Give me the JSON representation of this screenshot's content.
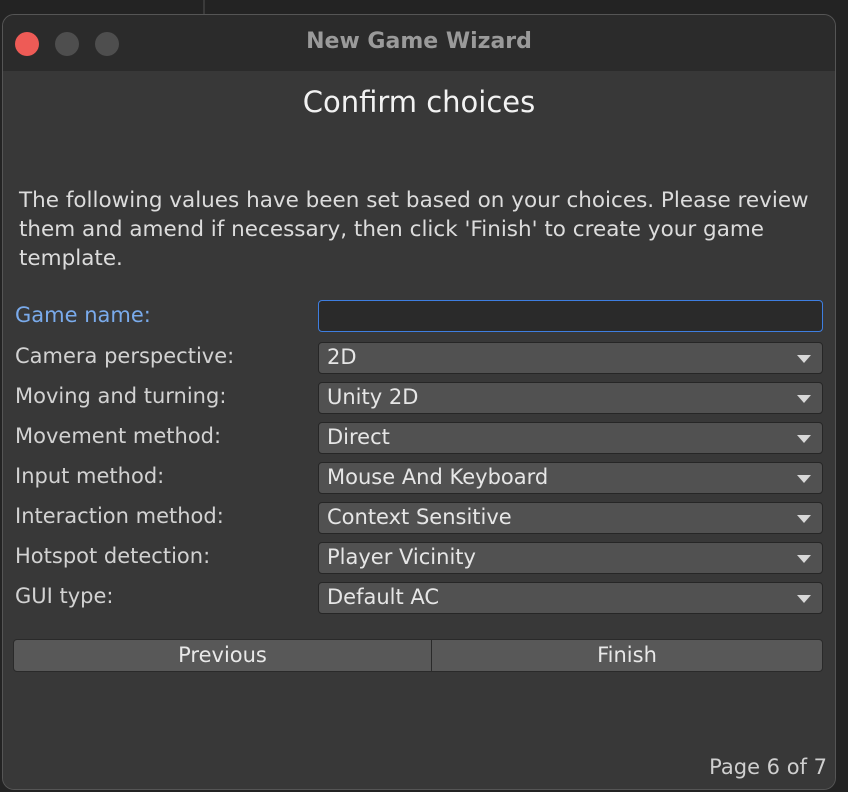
{
  "window": {
    "title": "New Game Wizard"
  },
  "page": {
    "heading": "Confirm choices",
    "description": "The following values have been set based on your choices. Please review them and amend if necessary, then click 'Finish' to create your game template.",
    "indicator": "Page 6 of 7"
  },
  "form": {
    "game_name": {
      "label": "Game name:",
      "value": ""
    },
    "fields": [
      {
        "label": "Camera perspective:",
        "value": "2D"
      },
      {
        "label": "Moving and turning:",
        "value": "Unity 2D"
      },
      {
        "label": "Movement method:",
        "value": "Direct"
      },
      {
        "label": "Input method:",
        "value": "Mouse And Keyboard"
      },
      {
        "label": "Interaction method:",
        "value": "Context Sensitive"
      },
      {
        "label": "Hotspot detection:",
        "value": "Player Vicinity"
      },
      {
        "label": "GUI type:",
        "value": "Default AC"
      }
    ]
  },
  "buttons": {
    "previous": "Previous",
    "finish": "Finish"
  },
  "colors": {
    "accent": "#3e7ee0",
    "active_label": "#7aabec",
    "close_button": "#ee5b56",
    "window_bg": "#383838"
  }
}
